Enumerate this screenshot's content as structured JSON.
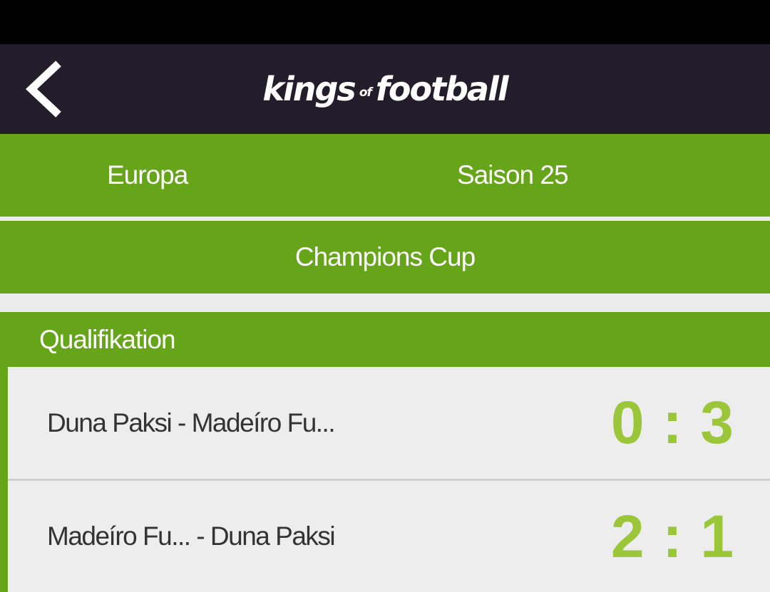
{
  "header": {
    "logo_part1": "kings",
    "logo_part2": "of",
    "logo_part3": "football",
    "back_icon": "chevron-left-icon"
  },
  "nav": {
    "region": "Europa",
    "season": "Saison 25"
  },
  "competition": {
    "name": "Champions Cup"
  },
  "section": {
    "title": "Qualifikation"
  },
  "matches": [
    {
      "teams": "Duna Paksi - Madeíro Fu...",
      "score": "0 : 3"
    },
    {
      "teams": "Madeíro Fu... - Duna Paksi",
      "score": "2 : 1"
    }
  ],
  "colors": {
    "header_bg": "#231d2b",
    "accent_green": "#66a51a",
    "score_green": "#9bc63a",
    "row_bg": "#ededed"
  }
}
